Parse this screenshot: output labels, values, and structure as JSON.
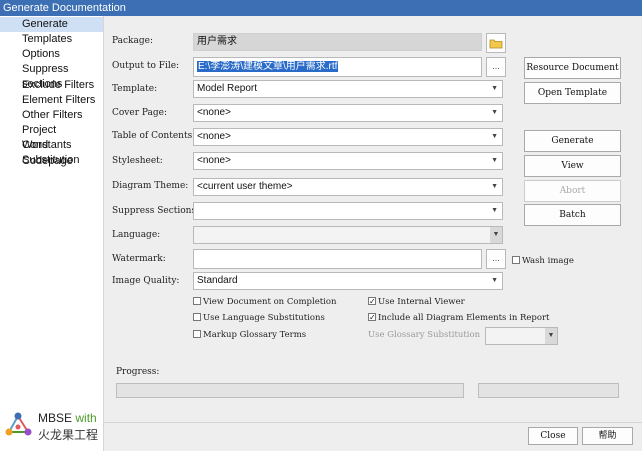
{
  "window": {
    "title": "Generate Documentation"
  },
  "sidebar": {
    "items": [
      {
        "label": "Generate",
        "selected": true
      },
      {
        "label": "Templates"
      },
      {
        "label": "Options"
      },
      {
        "label": "Suppress sections"
      },
      {
        "label": "Exclude Filters"
      },
      {
        "label": "Element Filters"
      },
      {
        "label": "Other Filters"
      },
      {
        "label": "Project Constants"
      },
      {
        "label": "Word Substitution"
      },
      {
        "label": "Codepage"
      }
    ]
  },
  "form": {
    "package_label": "Package:",
    "package_value": "用户需求",
    "output_label": "Output to File:",
    "output_value": "E:\\李澎涛\\建模文章\\用户需求.rtf",
    "browse_label": "...",
    "template_label": "Template:",
    "template_value": "Model Report",
    "cover_label": "Cover Page:",
    "cover_value": "<none>",
    "toc_label": "Table of Contents:",
    "toc_value": "<none>",
    "stylesheet_label": "Stylesheet:",
    "stylesheet_value": "<none>",
    "theme_label": "Diagram Theme:",
    "theme_value": "<current user theme>",
    "suppress_label": "Suppress Sections",
    "suppress_value": "",
    "language_label": "Language:",
    "language_value": "",
    "watermark_label": "Watermark:",
    "watermark_value": "",
    "wash_label": "Wash image",
    "quality_label": "Image Quality:",
    "quality_value": "Standard"
  },
  "checks": {
    "view_doc": {
      "label": "View Document on Completion",
      "checked": false
    },
    "internal_viewer": {
      "label": "Use Internal Viewer",
      "checked": true
    },
    "lang_subst": {
      "label": "Use Language Substitutions",
      "checked": false
    },
    "include_all": {
      "label": "Include all Diagram Elements in Report",
      "checked": true
    },
    "glossary": {
      "label": "Markup Glossary Terms",
      "checked": false
    },
    "glossary_subst_label": "Use Glossary Substitution"
  },
  "buttons": {
    "resource": "Resource Document",
    "open_template": "Open Template",
    "generate": "Generate",
    "view": "View",
    "abort": "Abort",
    "batch": "Batch",
    "close": "Close",
    "help": "帮助"
  },
  "progress": {
    "label": "Progress:",
    "value": 0
  },
  "logo": {
    "line1": "MBSE",
    "line1b": "with",
    "line2": "火龙果工程"
  },
  "colors": {
    "titlebar": "#3c6fb3",
    "selection": "#2a6bc9",
    "nav_selected": "#cfe0f5",
    "logo_green": "#4d9a2a"
  }
}
